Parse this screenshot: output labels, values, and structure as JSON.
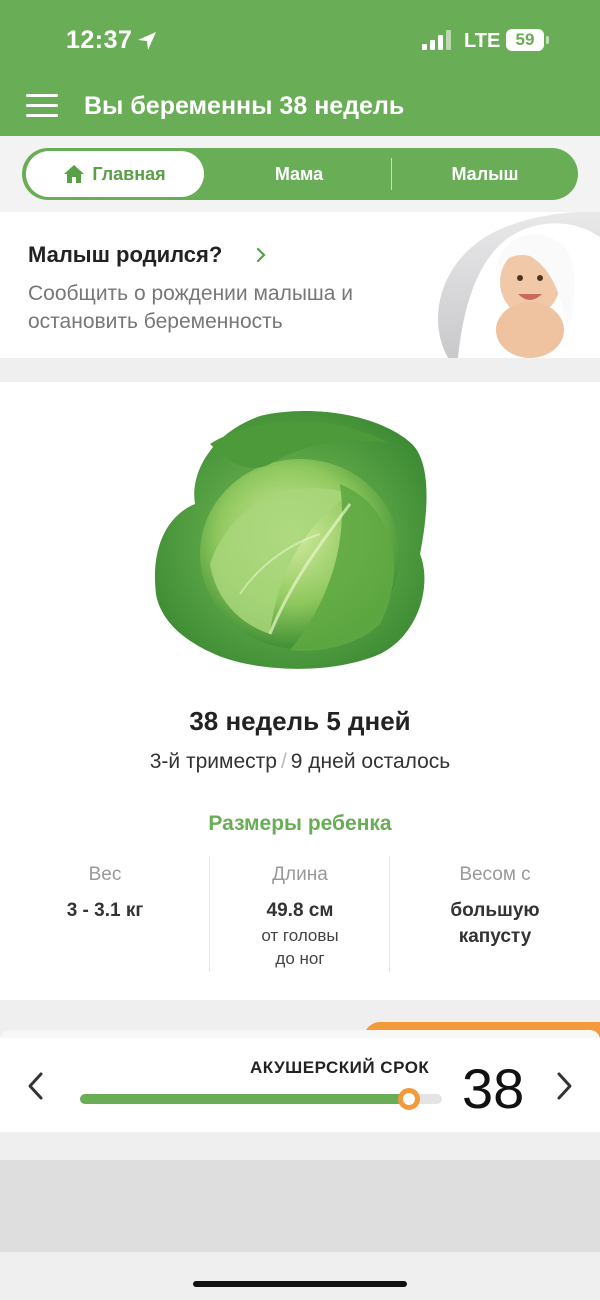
{
  "status_bar": {
    "time": "12:37",
    "network": "LTE",
    "battery": "59"
  },
  "header": {
    "title": "Вы беременны 38 недель"
  },
  "tabs": [
    {
      "label": "Главная",
      "icon": "home-icon",
      "active": true
    },
    {
      "label": "Мама"
    },
    {
      "label": "Малыш"
    }
  ],
  "banner": {
    "title": "Малыш родился?",
    "subtitle": "Сообщить о рождении малыша и остановить беременность"
  },
  "pregnancy": {
    "week_title": "38 недель 5 дней",
    "trimester": "3-й триместр",
    "separator": "/",
    "remaining": "9 дней осталось"
  },
  "sizes": {
    "title": "Размеры ребенка",
    "weight": {
      "label": "Вес",
      "value": "3 - 3.1 кг"
    },
    "length": {
      "label": "Длина",
      "value": "49.8 см",
      "note1": "от головы",
      "note2": "до ног"
    },
    "compare": {
      "label": "Весом с",
      "value1": "большую",
      "value2": "капусту"
    }
  },
  "term": {
    "label": "АКУШЕРСКИЙ СРОК",
    "week": "38",
    "progress": 0.91
  },
  "colors": {
    "accent": "#69ad56",
    "highlight": "#f39a3a"
  }
}
